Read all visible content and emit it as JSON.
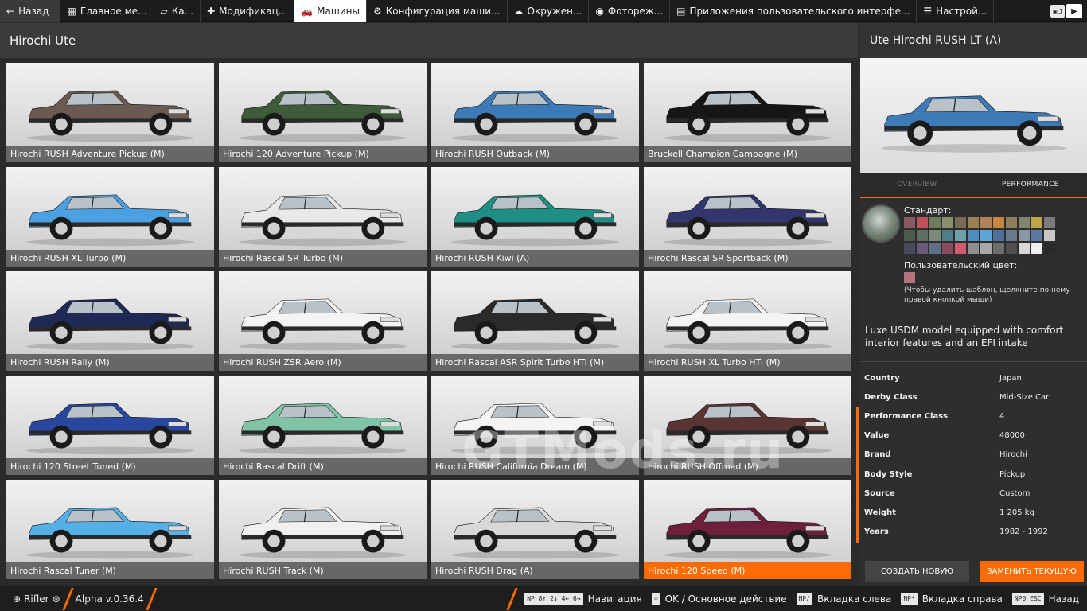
{
  "topbar": {
    "back_label": "Назад",
    "tabs": [
      {
        "label": "Главное ме...",
        "icon": "dashboard-icon"
      },
      {
        "label": "Ка...",
        "icon": "map-icon"
      },
      {
        "label": "Модификац...",
        "icon": "puzzle-icon"
      },
      {
        "label": "Машины",
        "icon": "car-icon",
        "active": true
      },
      {
        "label": "Конфигурация маши...",
        "icon": "engine-icon"
      },
      {
        "label": "Окружен...",
        "icon": "weather-icon"
      },
      {
        "label": "Фотореж...",
        "icon": "camera-icon"
      },
      {
        "label": "Приложения пользовательского интерфе...",
        "icon": "apps-icon"
      },
      {
        "label": "Настрой...",
        "icon": "settings-icon"
      }
    ],
    "shortcut_key": "J"
  },
  "list": {
    "title": "Hirochi Ute",
    "vehicles": [
      {
        "name": "Hirochi RUSH Adventure Pickup (M)",
        "color": "#6b5a52"
      },
      {
        "name": "Hirochi 120 Adventure Pickup (M)",
        "color": "#3f5c3a"
      },
      {
        "name": "Hirochi RUSH Outback (M)",
        "color": "#3d7ab8"
      },
      {
        "name": "Bruckell Champion Campagne (M)",
        "color": "#161616"
      },
      {
        "name": "Hirochi RUSH XL Turbo (M)",
        "color": "#4aa0e0"
      },
      {
        "name": "Hirochi Rascal SR Turbo (M)",
        "color": "#e8e8e8"
      },
      {
        "name": "Hirochi RUSH Kiwi (A)",
        "color": "#1f8e84"
      },
      {
        "name": "Hirochi Rascal SR Sportback (M)",
        "color": "#33366e"
      },
      {
        "name": "Hirochi RUSH Rally (M)",
        "color": "#1e2a55"
      },
      {
        "name": "Hirochi RUSH ZSR Aero (M)",
        "color": "#f4f4f4"
      },
      {
        "name": "Hirochi Rascal ASR Spirit Turbo HTi (M)",
        "color": "#2a2a2a"
      },
      {
        "name": "Hirochi RUSH XL Turbo HTi (M)",
        "color": "#f4f4f4"
      },
      {
        "name": "Hirochi 120 Street Tuned (M)",
        "color": "#2848a0"
      },
      {
        "name": "Hirochi Rascal Drift (M)",
        "color": "#7fc4a4"
      },
      {
        "name": "Hirochi RUSH California Dream (M)",
        "color": "#f4f4f4"
      },
      {
        "name": "Hirochi RUSH Offroad (M)",
        "color": "#5a3432"
      },
      {
        "name": "Hirochi Rascal Tuner (M)",
        "color": "#55b0e8"
      },
      {
        "name": "Hirochi RUSH Track (M)",
        "color": "#f0f0f0"
      },
      {
        "name": "Hirochi RUSH Drag (A)",
        "color": "#d8d8d8"
      },
      {
        "name": "Hirochi 120 Speed (M)",
        "color": "#6e1f3c"
      }
    ],
    "selected_index": 19
  },
  "detail": {
    "title": "Ute Hirochi RUSH LT (A)",
    "preview_color": "#3d7ab8",
    "tabs": [
      "OVERVIEW",
      "PERFORMANCE"
    ],
    "active_tab": 1,
    "standard_label": "Стандарт:",
    "swatches": [
      "#8a5a62",
      "#c0505a",
      "#6f7d5f",
      "#8b8f6a",
      "#7a6a55",
      "#9a7f57",
      "#b0825a",
      "#c98642",
      "#8f7e5a",
      "#7f8570",
      "#bfa54a",
      "#7a7a7a",
      "#4e5a4e",
      "#5f6e63",
      "#7b8b7a",
      "#4f7e86",
      "#6ea0a8",
      "#4f8fbf",
      "#5fa6d8",
      "#4e6f9a",
      "#6a7a8a",
      "#8a97a5",
      "#5c7aa0",
      "#c8c8c8",
      "#4a4a5e",
      "#6a5a7a",
      "#5f6f85",
      "#8a4a5e",
      "#d05a6e",
      "#8f8f8f",
      "#a8a8a8",
      "#6f6f6f",
      "#4f4f4f",
      "#d8d8d8",
      "#f0f0f0",
      "#2a2a2a"
    ],
    "custom_label": "Пользовательский цвет:",
    "custom_color": "#b57380",
    "custom_hint": "(Чтобы удалить шаблон, щелкните по нему правой кнопкой мыши)",
    "description": "Luxe USDM model equipped with comfort interior features and an EFI intake",
    "properties": [
      {
        "key": "Country",
        "value": "Japan"
      },
      {
        "key": "Derby Class",
        "value": "Mid-Size Car"
      },
      {
        "key": "Performance Class",
        "value": "4"
      },
      {
        "key": "Value",
        "value": "48000"
      },
      {
        "key": "Brand",
        "value": "Hirochi"
      },
      {
        "key": "Body Style",
        "value": "Pickup"
      },
      {
        "key": "Source",
        "value": "Custom"
      },
      {
        "key": "Weight",
        "value": "1 205 kg"
      },
      {
        "key": "Years",
        "value": "1982 - 1992"
      }
    ],
    "btn_new": "СОЗДАТЬ НОВУЮ",
    "btn_replace": "ЗАМЕНИТЬ ТЕКУЩУЮ"
  },
  "bottombar": {
    "user": "Rifler",
    "version": "Alpha v.0.36.4",
    "hints": [
      {
        "keys": "NP 8↑ 2↓ 4← 6→",
        "label": "Навигация"
      },
      {
        "keys": "⏎",
        "label": "OK / Основное действие"
      },
      {
        "keys": "NP/",
        "label": "Вкладка слева"
      },
      {
        "keys": "NP*",
        "label": "Вкладка справа"
      },
      {
        "keys": "NP0 ESC",
        "label": "Назад"
      }
    ]
  },
  "watermark": "GTMods.ru"
}
